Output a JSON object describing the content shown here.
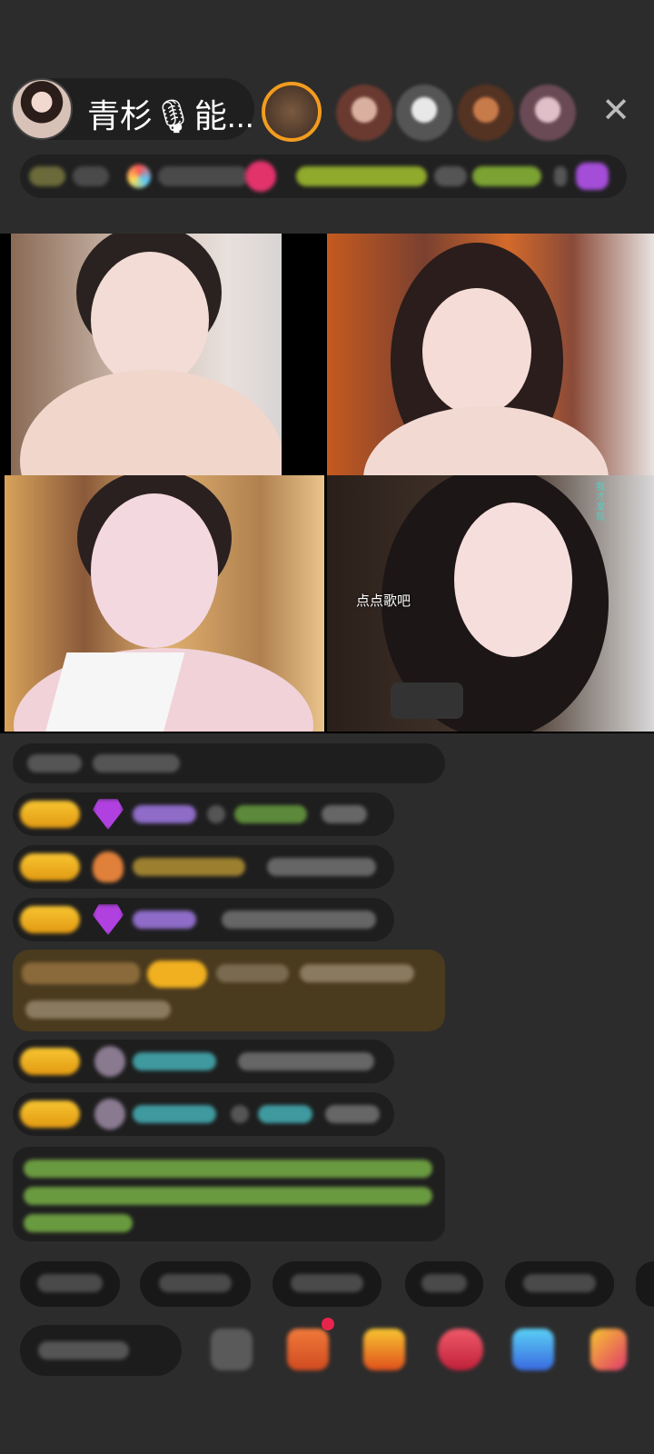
{
  "header": {
    "host_name": "青杉🎙能...",
    "close_label": "✕"
  },
  "video": {
    "song_hint": "点点歌吧",
    "tile4_badge": "我才发现"
  },
  "colors": {
    "background": "#2c2c2c",
    "level_badge": "#f5b81c",
    "username_purple": "#a78bfa",
    "username_cyan": "#4fc3c8",
    "system_green": "#9ccc65",
    "gift_bg": "#4a3a1e"
  },
  "icons": [
    "close-icon",
    "gem-icon",
    "emoji-icon",
    "gift-icon",
    "message-icon",
    "more-icon"
  ]
}
